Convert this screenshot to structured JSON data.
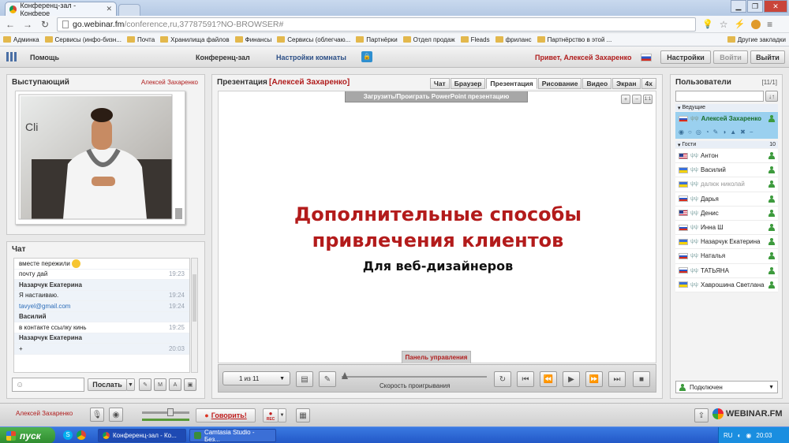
{
  "browser": {
    "tab_title": "Конференц-зал - Конфере",
    "url_host": "go.webinar.fm",
    "url_path": "/conference,ru,37787591?NO-BROWSER#",
    "bookmarks": [
      "Админка",
      "Сервисы (инфо-бизн...",
      "Почта",
      "Хранилища файлов",
      "Финансы",
      "Сервисы (облегчаю...",
      "Партнёрки",
      "Отдел продаж",
      "Fleads",
      "фриланс",
      "Партнёрство в этой ..."
    ],
    "other_bookmarks": "Другие закладки"
  },
  "app_header": {
    "help": "Помощь",
    "room": "Конференц-зал",
    "room_settings": "Настройки комнаты",
    "greeting": "Привет, Алексей Захаренко",
    "settings_btn": "Настройки",
    "login_btn": "Войти",
    "logout_btn": "Выйти"
  },
  "speaker": {
    "title": "Выступающий",
    "name": "Алексей Захаренко"
  },
  "chat": {
    "title": "Чат",
    "messages": [
      {
        "text": "вместе пережили",
        "time": "",
        "style": "msg"
      },
      {
        "text": "почту дай",
        "time": "19:23",
        "style": "msg"
      },
      {
        "text": "Назарчук Екатерина",
        "time": "",
        "style": "name"
      },
      {
        "text": "Я настаиваю.",
        "time": "19:24",
        "style": "alt"
      },
      {
        "text": "tavyel@gmail.com",
        "time": "19:24",
        "style": "alt-link"
      },
      {
        "text": "Василий",
        "time": "",
        "style": "name"
      },
      {
        "text": "в контакте ссылку кинь",
        "time": "19:25",
        "style": "msg"
      },
      {
        "text": "Назарчук Екатерина",
        "time": "",
        "style": "name"
      },
      {
        "text": "+",
        "time": "20:03",
        "style": "alt"
      }
    ],
    "send_btn": "Послать"
  },
  "presentation": {
    "title": "Презентация",
    "presenter": "[Алексей Захаренко]",
    "tabs": [
      "Чат",
      "Браузер",
      "Презентация",
      "Рисование",
      "Видео",
      "Экран",
      "4x"
    ],
    "active_tab": "Презентация",
    "upload_btn": "Загрузить/Проиграть PowerPoint презентацию",
    "slide_title_line1": "Дополнительные способы",
    "slide_title_line2": "привлечения клиентов",
    "slide_subtitle": "Для веб-дизайнеров",
    "control_panel_label": "Панель управления",
    "page_select": "1 из 11",
    "speed_label": "Скорость проигрывания"
  },
  "users": {
    "title": "Пользователи",
    "count": "[11/1]",
    "group_hosts": "Ведущие",
    "group_guests": "Гости",
    "guests_count": "10",
    "host": "Алексей Захаренко",
    "guests": [
      {
        "name": "Антон",
        "flag": "us"
      },
      {
        "name": "Василий",
        "flag": "ua"
      },
      {
        "name": "далюк николай",
        "flag": "ua"
      },
      {
        "name": "Дарья",
        "flag": "ru"
      },
      {
        "name": "Денис",
        "flag": "us"
      },
      {
        "name": "Инна Ш",
        "flag": "ru"
      },
      {
        "name": "Назарчук Екатерина",
        "flag": "ua"
      },
      {
        "name": "Наталья",
        "flag": "ru"
      },
      {
        "name": "ТАТЬЯНА",
        "flag": "ru"
      },
      {
        "name": "Хаврошина Светлана",
        "flag": "ua"
      }
    ],
    "status": "Подключен"
  },
  "bottom_bar": {
    "user": "Алексей Захаренко",
    "speak_btn": "Говорить!",
    "rec": "REC",
    "brand": "WEBINAR.FM"
  },
  "taskbar": {
    "start": "пуск",
    "tasks": [
      "Конференц-зал - Ко...",
      "Camtasia Studio - Без..."
    ],
    "lang": "RU",
    "clock": "20:03"
  }
}
